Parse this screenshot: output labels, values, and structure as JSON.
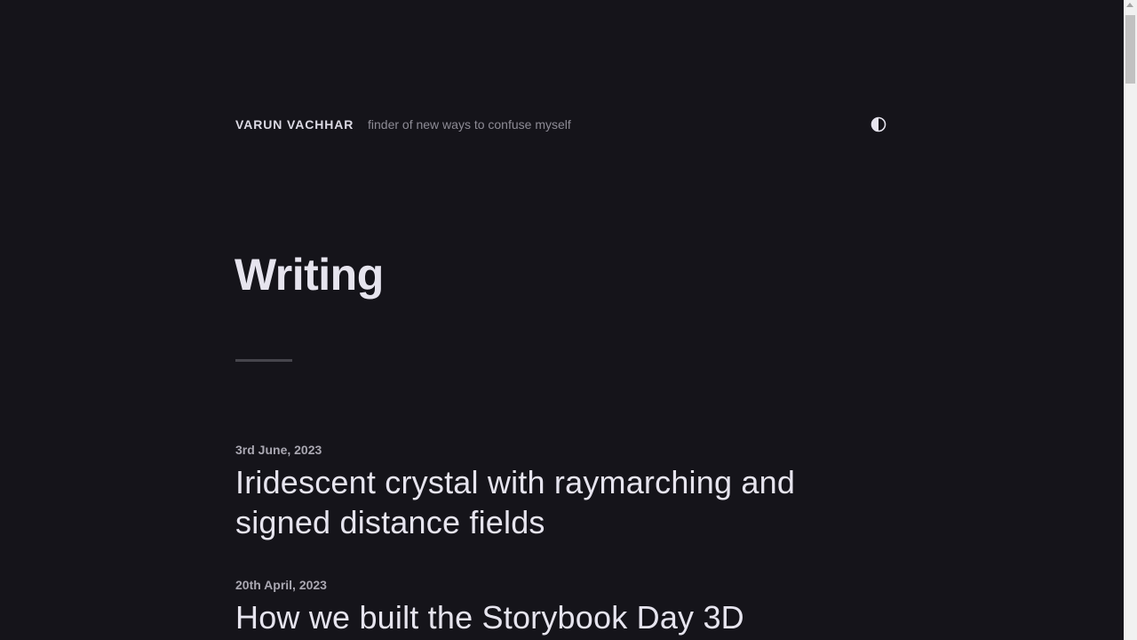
{
  "header": {
    "site_name": "VARUN VACHHAR",
    "tagline": "finder of new ways to confuse myself",
    "theme_toggle_icon": "half-circle-contrast-icon"
  },
  "main": {
    "heading": "Writing",
    "posts": [
      {
        "date": "3rd June, 2023",
        "title": "Iridescent crystal with raymarching and signed distance fields"
      },
      {
        "date": "20th April, 2023",
        "title": "How we built the Storybook Day 3D"
      }
    ]
  },
  "colors": {
    "background": "#15141a",
    "text": "#e6e4ee",
    "muted": "#8d8b95",
    "date": "#a9a7b1",
    "divider": "#46454c"
  }
}
